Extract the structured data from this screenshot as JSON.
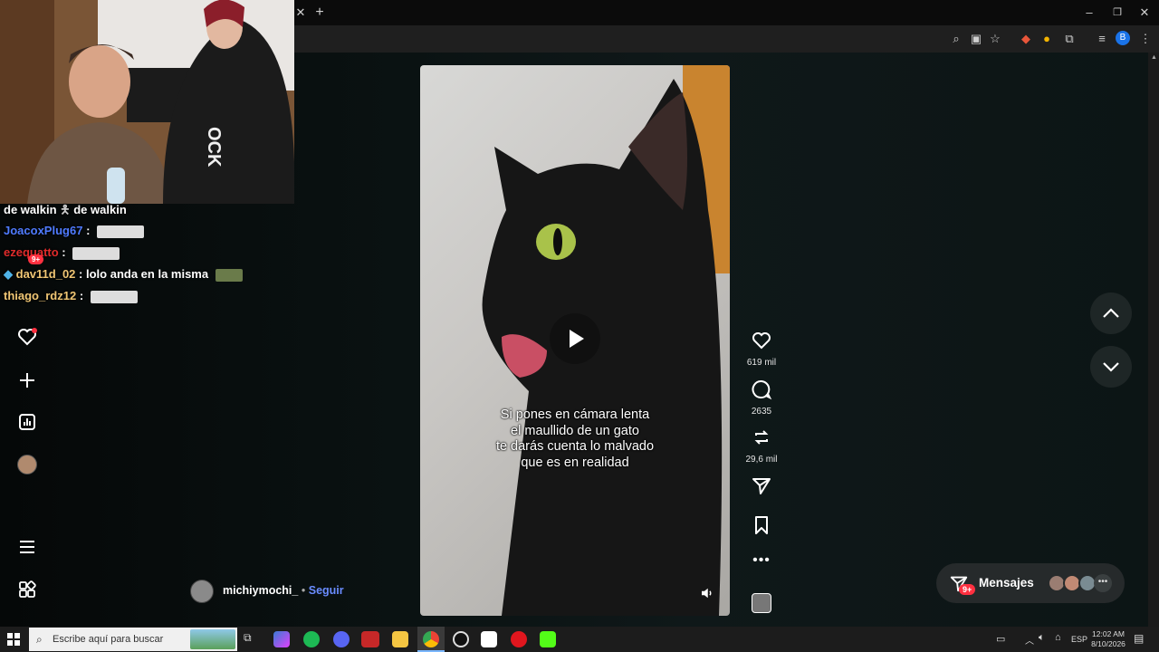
{
  "chat": {
    "lines": [
      {
        "user": "de walkin",
        "text": "de walkin",
        "color": "#ffffff"
      },
      {
        "user": "JoacoxPlug67",
        "sep": ":",
        "color": "#4f7bff"
      },
      {
        "user": "ezequatto",
        "sep": ":",
        "color": "#e02b2b"
      },
      {
        "user": "dav11d_02",
        "sep": ":",
        "text": "lolo anda en la misma",
        "color": "#f0c674"
      },
      {
        "user": "thiago_rdz12",
        "sep": ":",
        "color": "#f0c674"
      }
    ],
    "badge": "9+"
  },
  "video": {
    "caption": [
      "Si pones en cámara lenta",
      "el maullido de un gato",
      "te darás cuenta lo malvado",
      "que es en realidad"
    ],
    "author": "michiymochi_",
    "follow_sep": "•",
    "follow": "Seguir"
  },
  "actions": {
    "likes": "619 mil",
    "comments": "2635",
    "reposts": "29,6 mil"
  },
  "messages": {
    "label": "Mensajes",
    "badge": "9+"
  },
  "taskbar": {
    "search_placeholder": "Escribe aquí para buscar",
    "lang": "ESP",
    "time": "12:02 AM",
    "date": "8/10/2026"
  },
  "colors": {
    "page_bg": "#0c1515",
    "accent_red": "#ff3040",
    "follow_blue": "#6a8cff"
  }
}
